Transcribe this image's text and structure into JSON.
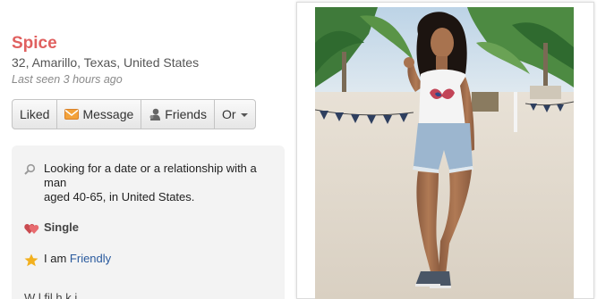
{
  "profile": {
    "name": "Spice",
    "location": "32, Amarillo, Texas, United States",
    "last_seen": "Last seen 3 hours ago"
  },
  "actions": {
    "liked": "Liked",
    "message": "Message",
    "friends": "Friends",
    "or": "Or"
  },
  "details": {
    "looking_line1": "Looking for a date or a relationship with a man",
    "looking_line2": "aged 40-65, in United States.",
    "status": "Single",
    "i_am_prefix": "I am",
    "i_am_value": "Friendly",
    "truncated_text": "W l               fil      h        k       i"
  },
  "icons": {
    "search": "search-icon",
    "message": "envelope-icon",
    "friends": "person-icon",
    "heart": "hearts-icon",
    "star": "star-icon"
  },
  "colors": {
    "name": "#e0605f",
    "link": "#2a5a9e",
    "heart": "#e0555a",
    "star": "#f2b01e"
  }
}
